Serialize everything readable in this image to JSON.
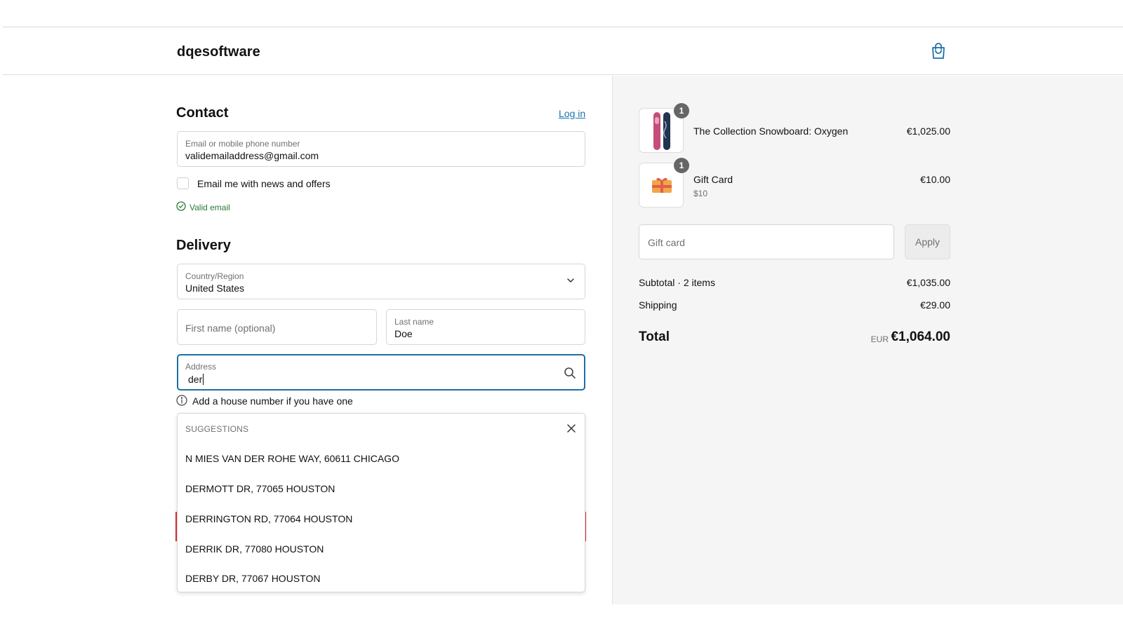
{
  "header": {
    "brand": "dqesoftware",
    "cart_icon": "shopping-bag-icon"
  },
  "contact": {
    "title": "Contact",
    "login_link": "Log in",
    "email_label": "Email or mobile phone number",
    "email_value": "validemailaddress@gmail.com",
    "newsletter_label": "Email me with news and offers",
    "newsletter_checked": false,
    "valid_text": "Valid email"
  },
  "delivery": {
    "title": "Delivery",
    "country_label": "Country/Region",
    "country_value": "United States",
    "first_name_placeholder": "First name (optional)",
    "last_name_label": "Last name",
    "last_name_value": "Doe",
    "address_label": "Address",
    "address_value": "der",
    "address_hint": "Add a house number if you have one"
  },
  "suggestions": {
    "heading": "SUGGESTIONS",
    "items": [
      "N MIES VAN DER ROHE WAY, 60611 CHICAGO",
      "DERMOTT DR, 77065 HOUSTON",
      "DERRINGTON RD, 77064 HOUSTON",
      "DERRIK DR, 77080 HOUSTON",
      "DERBY DR, 77067 HOUSTON"
    ]
  },
  "order": {
    "lines": [
      {
        "name": "The Collection Snowboard: Oxygen",
        "sub": "",
        "price": "€1,025.00",
        "qty": "1"
      },
      {
        "name": "Gift Card",
        "sub": "$10",
        "price": "€10.00",
        "qty": "1"
      }
    ],
    "gift_placeholder": "Gift card",
    "apply_label": "Apply",
    "subtotal_label": "Subtotal · 2 items",
    "subtotal_value": "€1,035.00",
    "shipping_label": "Shipping",
    "shipping_value": "€29.00",
    "total_label": "Total",
    "total_currency": "EUR",
    "total_value": "€1,064.00"
  },
  "colors": {
    "accent": "#1d6fa5",
    "link": "#1773b0",
    "valid": "#2a7a36",
    "error": "#e32c2b",
    "summary_bg": "#f5f5f5"
  }
}
